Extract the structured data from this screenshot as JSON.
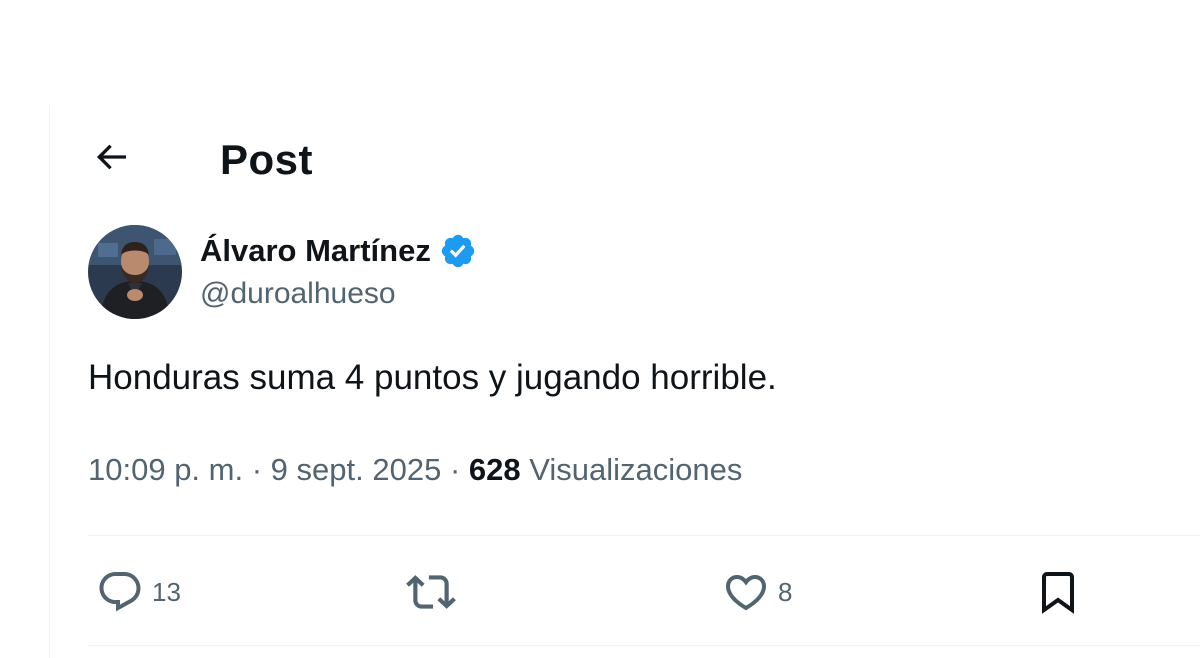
{
  "header": {
    "back_icon": "arrow-left-icon",
    "title": "Post"
  },
  "author": {
    "display_name": "Álvaro Martínez",
    "verified_icon": "verified-badge-icon",
    "handle": "@duroalhueso"
  },
  "post": {
    "text": "Honduras suma 4 puntos y jugando horrible.",
    "time": "10:09 p. m.",
    "separator": "·",
    "date": "9 sept. 2025",
    "views_count": "628",
    "views_label": "Visualizaciones"
  },
  "actions": {
    "reply_icon": "reply-icon",
    "reply_count": "13",
    "repost_icon": "repost-icon",
    "like_icon": "heart-icon",
    "like_count": "8",
    "bookmark_icon": "bookmark-icon"
  },
  "colors": {
    "primary_text": "#0f1419",
    "secondary_text": "#536471",
    "verified_blue": "#1d9bf0",
    "divider": "#eff3f4"
  }
}
